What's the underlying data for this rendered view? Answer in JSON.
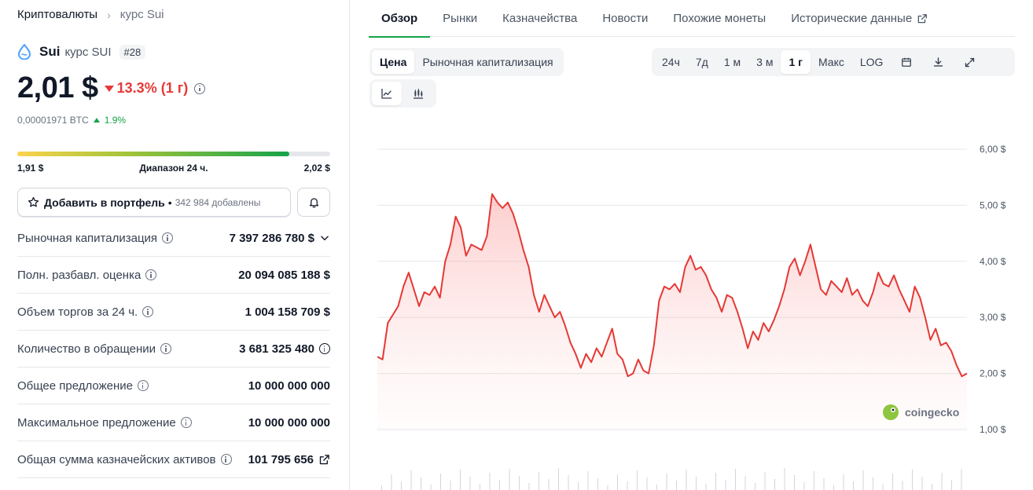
{
  "breadcrumb": {
    "root": "Криптовалюты",
    "current": "курс Sui"
  },
  "coin": {
    "name": "Sui",
    "subtitle": "курс SUI",
    "rank": "#28"
  },
  "price": {
    "value": "2,01 $",
    "change": "13.3% (1 г)",
    "btc_value": "0,00001971 BTC",
    "btc_change": "1.9%"
  },
  "range_24h": {
    "low": "1,91 $",
    "label": "Диапазон 24 ч.",
    "high": "2,02 $",
    "fill_fraction": 0.87
  },
  "portfolio": {
    "label": "Добавить в портфель",
    "dot": "•",
    "count": "342 984 добавлены"
  },
  "stats": [
    {
      "label": "Рыночная капитализация",
      "value": "7 397 286 780 $"
    },
    {
      "label": "Полн. разбавл. оценка",
      "value": "20 094 085 188 $"
    },
    {
      "label": "Объем торгов за 24 ч.",
      "value": "1 004 158 709 $"
    },
    {
      "label": "Количество в обращении",
      "value": "3 681 325 480"
    },
    {
      "label": "Общее предложение",
      "value": "10 000 000 000"
    },
    {
      "label": "Максимальное предложение",
      "value": "10 000 000 000"
    },
    {
      "label": "Общая сумма казначейских активов",
      "value": "101 795 656"
    }
  ],
  "tabs": [
    "Обзор",
    "Рынки",
    "Казначейства",
    "Новости",
    "Похожие монеты",
    "Исторические данные"
  ],
  "chart_controls": {
    "metric_tabs": [
      "Цена",
      "Рыночная капитализация"
    ],
    "ranges": [
      "24ч",
      "7д",
      "1 м",
      "3 м",
      "1 г",
      "Макс",
      "LOG"
    ],
    "active_range": "1 г"
  },
  "watermark": "coingecko",
  "colors": {
    "accent": "#16a34a",
    "down": "#e53935",
    "line": "#e53935"
  },
  "chart_data": {
    "type": "area",
    "title": "",
    "xlabel": "",
    "ylabel": "",
    "yticks": [
      "6,00 $",
      "5,00 $",
      "4,00 $",
      "3,00 $",
      "2,00 $",
      "1,00 $"
    ],
    "ylim": [
      1,
      6
    ],
    "series": [
      {
        "values": [
          2.3,
          2.25,
          2.9,
          3.05,
          3.2,
          3.55,
          3.8,
          3.5,
          3.2,
          3.45,
          3.4,
          3.55,
          3.35,
          4.0,
          4.3,
          4.8,
          4.6,
          4.1,
          4.3,
          4.25,
          4.2,
          4.45,
          5.2,
          5.05,
          4.95,
          5.05,
          4.85,
          4.55,
          4.2,
          3.9,
          3.4,
          3.1,
          3.4,
          3.2,
          3.0,
          3.1,
          2.85,
          2.55,
          2.35,
          2.1,
          2.35,
          2.2,
          2.45,
          2.3,
          2.55,
          2.8,
          2.35,
          2.25,
          1.95,
          2.0,
          2.25,
          2.05,
          2.0,
          2.5,
          3.3,
          3.55,
          3.5,
          3.6,
          3.45,
          3.9,
          4.1,
          3.85,
          3.9,
          3.75,
          3.5,
          3.35,
          3.1,
          3.4,
          3.35,
          3.1,
          2.8,
          2.45,
          2.75,
          2.6,
          2.9,
          2.75,
          2.95,
          3.2,
          3.5,
          3.9,
          4.05,
          3.75,
          4.0,
          4.3,
          3.9,
          3.5,
          3.4,
          3.65,
          3.55,
          3.45,
          3.7,
          3.4,
          3.5,
          3.3,
          3.2,
          3.45,
          3.8,
          3.6,
          3.55,
          3.75,
          3.5,
          3.3,
          3.1,
          3.55,
          3.35,
          3.0,
          2.6,
          2.8,
          2.5,
          2.55,
          2.4,
          2.15,
          1.95,
          2.0
        ]
      }
    ]
  }
}
